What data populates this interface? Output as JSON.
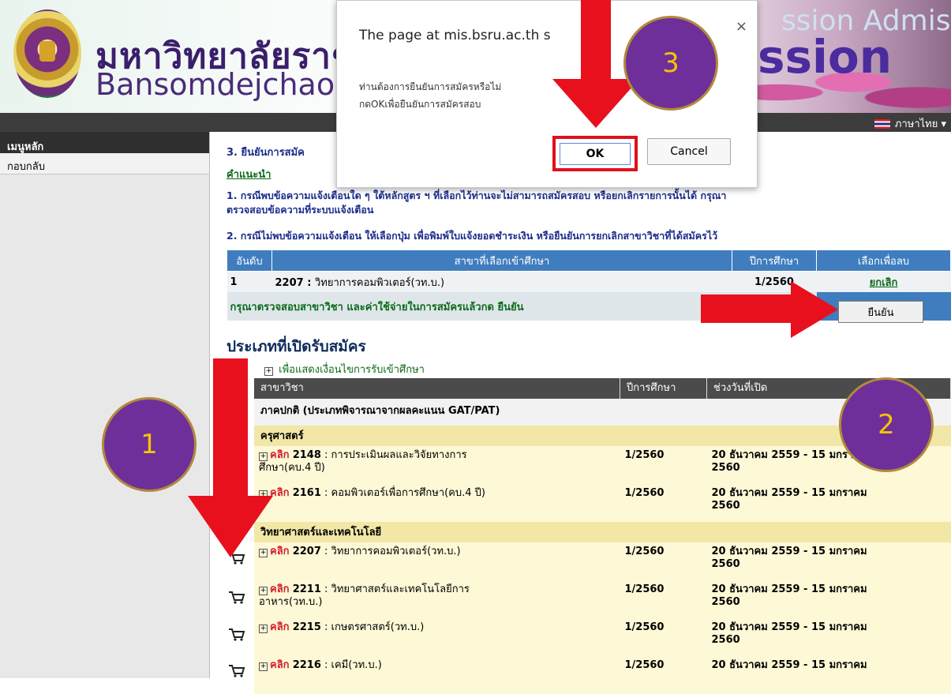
{
  "banner": {
    "univ_th": "มหาวิทยาลัยราชภัฏบ้าน",
    "univ_en": "Bansomdejchaopraya",
    "admission_bg": "ssion  Admiss",
    "admission": "ssion",
    "lang_label": "ภาษาไทย ▾"
  },
  "sidebar": {
    "header": "เมนูหลัก",
    "back": "กอบกลับ"
  },
  "main": {
    "step_title": "3. ยืนยันการสมัค",
    "advice_link": "คำแนะนำ",
    "note1_line1": "1. กรณีพบข้อความแจ้งเตือนใด ๆ ใต้หลักสูตร ฯ ที่เลือกไว้ท่านจะไม่สามารถสมัครสอบ หรือยกเลิกรายการนั้นได้ กรุณา",
    "note1_line2": "ตรวจสอบข้อความที่ระบบแจ้งเตือน",
    "note2": "2. กรณีไม่พบข้อความแจ้งเตือน ให้เลือกปุ่ม  เพื่อพิมพ์ใบแจ้งยอดชำระเงิน หรือยืนยันการยกเลิกสาขาวิชาที่ได้สมัครไว้",
    "sel_headers": [
      "อันดับ",
      "สาขาที่เลือกเข้าศึกษา",
      "ปีการศึกษา",
      "เลือกเพื่อลบ"
    ],
    "sel_row": {
      "rank": "1",
      "code": "2207",
      "major": "วิทยาการคอมพิวเตอร์(วท.บ.)",
      "year": "1/2560",
      "cancel": "ยกเลิก"
    },
    "confirm_text": "กรุณาตรวจสอบสาขาวิชา และค่าใช้จ่ายในการสมัครแล้วกด ยืนยัน",
    "confirm_button": "ยืนยัน",
    "open_types_title": "ประเภทที่เปิดรับสมัคร",
    "show_conditions": "เพื่อแสดงเงื่อนไขการรับเข้าศึกษา",
    "prog_headers": [
      "สาขาวิชา",
      "ปีการศึกษา",
      "ช่วงวันที่เปิด"
    ],
    "category": "ภาคปกติ (ประเภทพิจารณาจากผลคะแนน GAT/PAT)",
    "click_label": "คลิก",
    "faculty1": "ครุศาสตร์",
    "faculty2": "วิทยาศาสตร์และเทคโนโลยี",
    "programs_f1": [
      {
        "code": "2148",
        "name": "การประเมินผลและวิจัยทางการ",
        "name2": "ศึกษา(คบ.4 ปี)",
        "year": "1/2560",
        "dates": "20 ธันวาคม 2559 - 15 มกราคม",
        "dates2": "2560"
      },
      {
        "code": "2161",
        "name": "คอมพิวเตอร์เพื่อการศึกษา(คบ.4 ปี)",
        "name2": "",
        "year": "1/2560",
        "dates": "20 ธันวาคม 2559 - 15 มกราคม",
        "dates2": "2560"
      }
    ],
    "programs_f2": [
      {
        "code": "2207",
        "name": "วิทยาการคอมพิวเตอร์(วท.บ.)",
        "name2": "",
        "year": "1/2560",
        "dates": "20 ธันวาคม 2559 - 15 มกราคม",
        "dates2": "2560"
      },
      {
        "code": "2211",
        "name": "วิทยาศาสตร์และเทคโนโลยีการ",
        "name2": "อาหาร(วท.บ.)",
        "year": "1/2560",
        "dates": "20 ธันวาคม 2559 - 15 มกราคม",
        "dates2": "2560"
      },
      {
        "code": "2215",
        "name": "เกษตรศาสตร์(วท.บ.)",
        "name2": "",
        "year": "1/2560",
        "dates": "20 ธันวาคม 2559 - 15 มกราคม",
        "dates2": "2560"
      },
      {
        "code": "2216",
        "name": "เคมี(วท.บ.)",
        "name2": "",
        "year": "1/2560",
        "dates": "20 ธันวาคม 2559 - 15 มกราคม",
        "dates2": ""
      }
    ]
  },
  "dialog": {
    "title": "The page at mis.bsru.ac.th s",
    "message_line1": "ท่านต้องการยืนยันการสมัครหรือไม่",
    "message_line2": "กดOKเพื่อยืนยันการสมัครสอบ",
    "ok": "OK",
    "cancel": "Cancel",
    "close": "×"
  },
  "annotations": {
    "step1": "1",
    "step2": "2",
    "step3": "3"
  },
  "colors": {
    "header_blue": "#3f7dbf",
    "accent_red": "#e8101c",
    "circle_purple": "#6e2f9a",
    "step_yellow": "#f5c400"
  }
}
